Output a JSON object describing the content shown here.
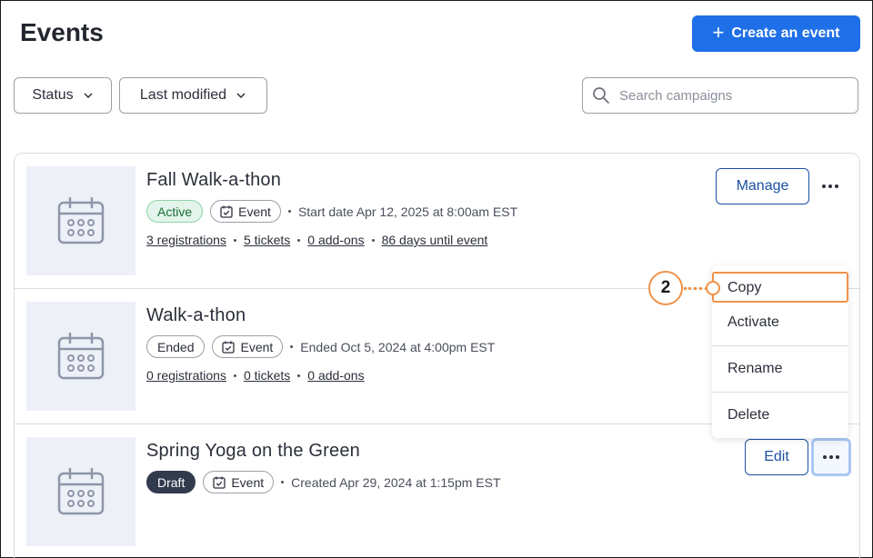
{
  "page": {
    "title": "Events"
  },
  "create_button": {
    "label": "Create an event",
    "icon": "plus-icon"
  },
  "filters": [
    {
      "label": "Status",
      "icon": "chevron-down-icon"
    },
    {
      "label": "Last modified",
      "icon": "chevron-down-icon"
    }
  ],
  "search": {
    "placeholder": "Search campaigns",
    "value": "",
    "icon": "search-icon"
  },
  "events": [
    {
      "title": "Fall Walk-a-thon",
      "status": "Active",
      "type": "Event",
      "date_text": "Start date Apr 12, 2025 at 8:00am EST",
      "links": [
        "3 registrations",
        "5 tickets",
        "0 add-ons",
        "86 days until event"
      ],
      "action_label": "Manage",
      "thumbnail_icon": "calendar-icon"
    },
    {
      "title": "Walk-a-thon",
      "status": "Ended",
      "type": "Event",
      "date_text": "Ended Oct 5, 2024 at 4:00pm EST",
      "links": [
        "0 registrations",
        "0 tickets",
        "0 add-ons"
      ],
      "thumbnail_icon": "calendar-icon"
    },
    {
      "title": "Spring Yoga on the Green",
      "status": "Draft",
      "type": "Event",
      "date_text": "Created Apr 29, 2024 at 1:15pm EST",
      "action_label": "Edit",
      "thumbnail_icon": "calendar-icon"
    }
  ],
  "context_menu": {
    "items": [
      "Copy",
      "Activate",
      "Rename",
      "Delete"
    ],
    "highlighted": "Copy"
  },
  "callout": {
    "step": "2",
    "color": "#f0924a"
  },
  "colors": {
    "primary": "#1f6fe8",
    "active_badge_bg": "#e3f5ea",
    "draft_badge_bg": "#323a4d",
    "thumb_bg": "#edf0f7"
  }
}
